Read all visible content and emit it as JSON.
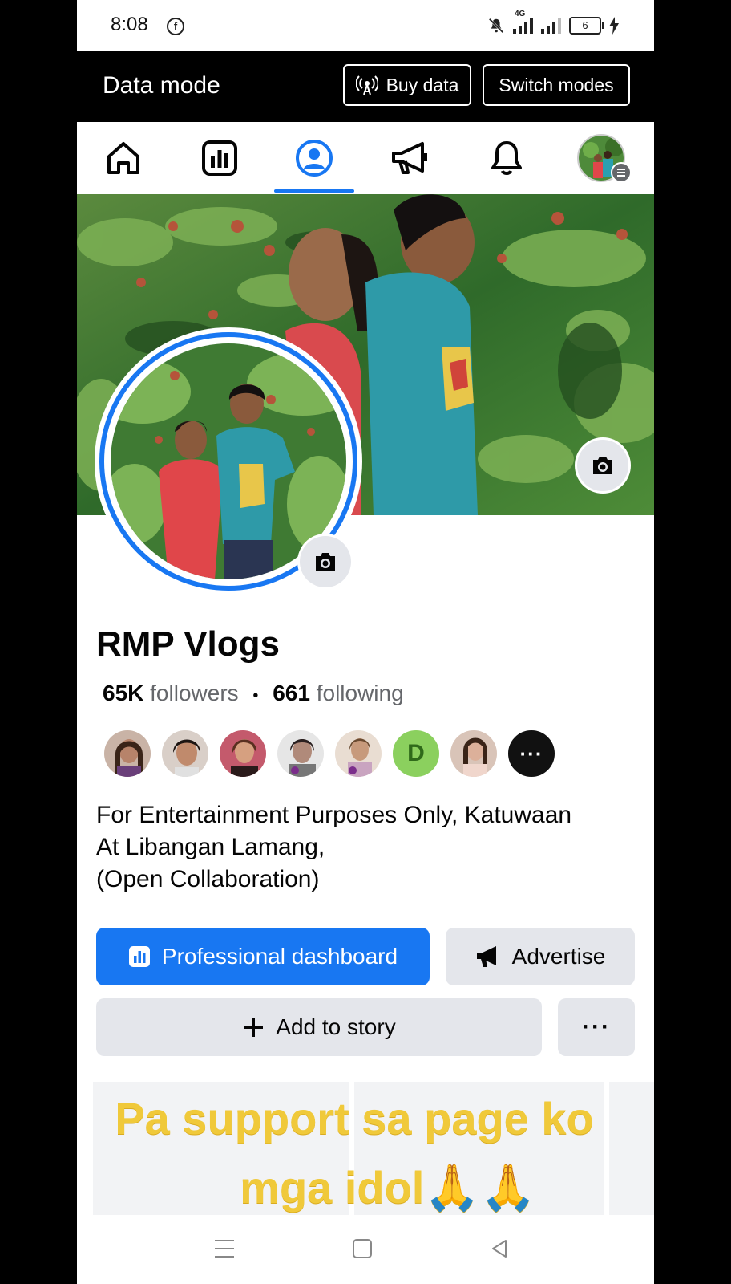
{
  "status_bar": {
    "time": "8:08",
    "network": "4G",
    "battery": "6"
  },
  "data_mode": {
    "title": "Data mode",
    "buy_label": "Buy data",
    "switch_label": "Switch modes"
  },
  "nav": [
    {
      "name": "home",
      "icon": "home-icon"
    },
    {
      "name": "insights",
      "icon": "insights-icon"
    },
    {
      "name": "profile",
      "icon": "profile-icon",
      "active": true
    },
    {
      "name": "ads",
      "icon": "megaphone-icon"
    },
    {
      "name": "notifications",
      "icon": "bell-icon"
    },
    {
      "name": "menu",
      "icon": "menu-avatar"
    }
  ],
  "profile": {
    "name": "RMP Vlogs",
    "followers_count": "65K",
    "followers_label": "followers",
    "separator": "•",
    "following_count": "661",
    "following_label": "following",
    "follower_avatars": [
      {
        "initial": ""
      },
      {
        "initial": ""
      },
      {
        "initial": ""
      },
      {
        "initial": ""
      },
      {
        "initial": ""
      },
      {
        "initial": "D"
      },
      {
        "initial": ""
      },
      {
        "initial": "···"
      }
    ],
    "bio_lines": [
      "For Entertainment Purposes Only, Katuwaan",
      "At Libangan Lamang,",
      "(Open Collaboration)"
    ]
  },
  "actions": {
    "pro_dashboard": "Professional dashboard",
    "advertise": "Advertise",
    "add_story": "Add to story",
    "more": "···"
  },
  "featured": {
    "line1": "Pa support sa page ko",
    "line2": "mga idol🙏🙏"
  },
  "colors": {
    "accent": "#1877f2",
    "button_grey": "#e4e6eb",
    "featured_text": "#f0c93a"
  }
}
